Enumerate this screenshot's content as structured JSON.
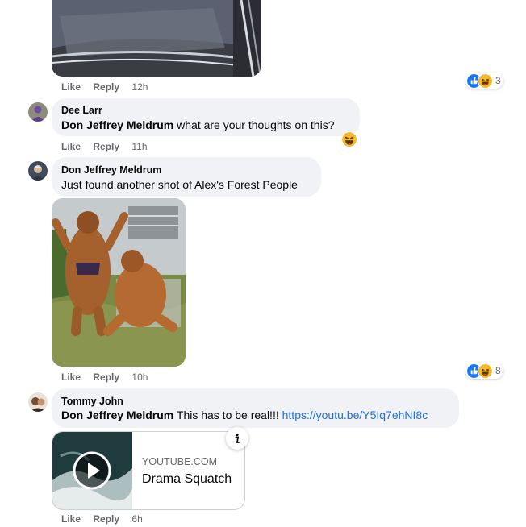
{
  "comments": [
    {
      "actions": {
        "like": "Like",
        "reply": "Reply",
        "time": "12h"
      },
      "reactions": {
        "count": "3",
        "icons": [
          "like-icon",
          "haha-icon"
        ]
      }
    },
    {
      "author": "Dee Larr",
      "mention": "Don Jeffrey Meldrum",
      "text": " what are your thoughts on this?",
      "actions": {
        "like": "Like",
        "reply": "Reply",
        "time": "11h"
      },
      "reactions": {
        "icons": [
          "haha-icon"
        ]
      }
    },
    {
      "author": "Don Jeffrey Meldrum",
      "text": "Just found another shot of Alex's Forest People",
      "actions": {
        "like": "Like",
        "reply": "Reply",
        "time": "10h"
      },
      "reactions": {
        "count": "8",
        "icons": [
          "like-icon",
          "haha-icon"
        ]
      }
    },
    {
      "author": "Tommy John",
      "mention": "Don Jeffrey Meldrum",
      "text": " This has to be real!!! ",
      "link": "https://youtu.be/Y5Iq7ehNI8c",
      "preview": {
        "domain": "YOUTUBE.COM",
        "title": "Drama Squatch"
      },
      "actions": {
        "like": "Like",
        "reply": "Reply",
        "time": "6h"
      }
    }
  ],
  "colors": {
    "like_blue": "#1877f2",
    "haha_yellow": "#f7b928",
    "link": "#216fdb",
    "bubble": "#f0f2f5",
    "meta": "#65676b"
  }
}
